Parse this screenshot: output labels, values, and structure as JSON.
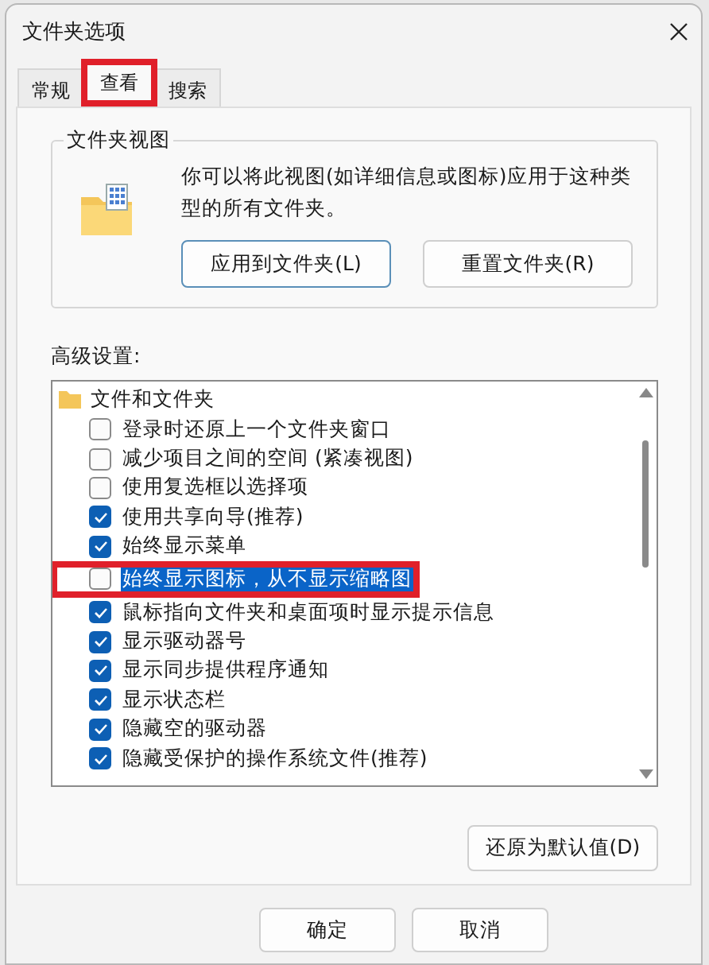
{
  "window": {
    "title": "文件夹选项"
  },
  "tabs": [
    {
      "label": "常规",
      "selected": false,
      "marked": false
    },
    {
      "label": "查看",
      "selected": true,
      "marked": true
    },
    {
      "label": "搜索",
      "selected": false,
      "marked": false
    }
  ],
  "folder_views": {
    "title": "文件夹视图",
    "description": "你可以将此视图(如详细信息或图标)应用于这种类型的所有文件夹。",
    "buttons": [
      "应用到文件夹(L)",
      "重置文件夹(R)"
    ]
  },
  "advanced": {
    "label": "高级设置:",
    "group": "文件和文件夹",
    "items": [
      {
        "label": "登录时还原上一个文件夹窗口",
        "checked": false,
        "selected": false,
        "marked": false
      },
      {
        "label": "减少项目之间的空间 (紧凑视图)",
        "checked": false,
        "selected": false,
        "marked": false
      },
      {
        "label": "使用复选框以选择项",
        "checked": false,
        "selected": false,
        "marked": false
      },
      {
        "label": "使用共享向导(推荐)",
        "checked": true,
        "selected": false,
        "marked": false
      },
      {
        "label": "始终显示菜单",
        "checked": true,
        "selected": false,
        "marked": false
      },
      {
        "label": "始终显示图标，从不显示缩略图",
        "checked": false,
        "selected": true,
        "marked": true
      },
      {
        "label": "鼠标指向文件夹和桌面项时显示提示信息",
        "checked": true,
        "selected": false,
        "marked": false
      },
      {
        "label": "显示驱动器号",
        "checked": true,
        "selected": false,
        "marked": false
      },
      {
        "label": "显示同步提供程序通知",
        "checked": true,
        "selected": false,
        "marked": false
      },
      {
        "label": "显示状态栏",
        "checked": true,
        "selected": false,
        "marked": false
      },
      {
        "label": "隐藏空的驱动器",
        "checked": true,
        "selected": false,
        "marked": false
      },
      {
        "label": "隐藏受保护的操作系统文件(推荐)",
        "checked": true,
        "selected": false,
        "marked": false
      }
    ],
    "restore_button": "还原为默认值(D)"
  },
  "footer_buttons": [
    "确定",
    "取消"
  ]
}
